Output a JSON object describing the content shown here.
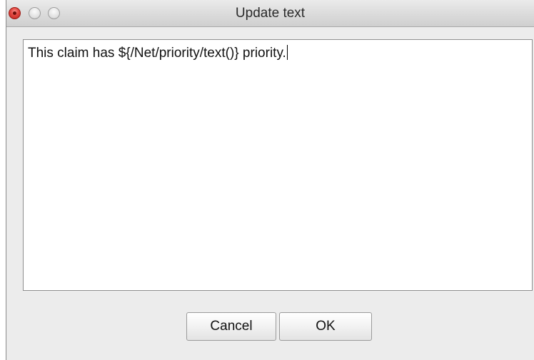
{
  "window": {
    "title": "Update text"
  },
  "editor": {
    "text": "This claim has ${/Net/priority/text()} priority."
  },
  "buttons": {
    "cancel_label": "Cancel",
    "ok_label": "OK"
  },
  "colors": {
    "close_button": "#e2463f",
    "window_background": "#ececec"
  }
}
